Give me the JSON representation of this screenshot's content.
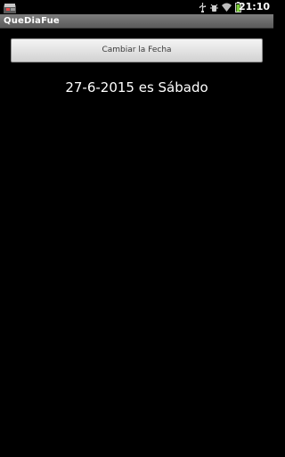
{
  "status_bar": {
    "time": "21:10",
    "icons": [
      "app-notification-icon",
      "usb-icon",
      "debug-icon",
      "wifi-icon",
      "battery-icon"
    ]
  },
  "app": {
    "title": "QueDiaFue"
  },
  "main": {
    "change_date_button_label": "Cambiar la Fecha",
    "result_text": "27-6-2015 es Sábado"
  },
  "colors": {
    "background": "#000000",
    "title_bar": "#6b6b6b",
    "battery_green": "#7ccf3a"
  }
}
